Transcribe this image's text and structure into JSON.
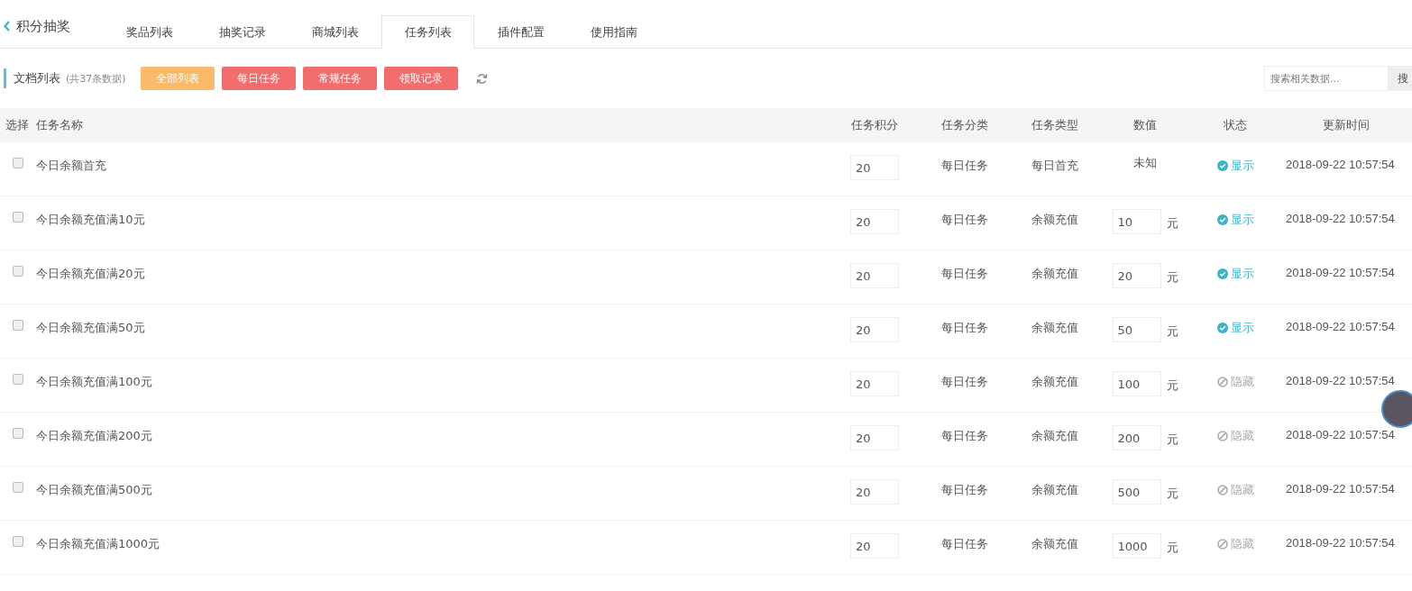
{
  "header": {
    "back_title": "积分抽奖",
    "tabs": [
      {
        "label": "奖品列表",
        "selected": false
      },
      {
        "label": "抽奖记录",
        "selected": false
      },
      {
        "label": "商城列表",
        "selected": false
      },
      {
        "label": "任务列表",
        "selected": true
      },
      {
        "label": "插件配置",
        "selected": false
      },
      {
        "label": "使用指南",
        "selected": false
      }
    ]
  },
  "toolbar": {
    "title": "文档列表",
    "count": "(共37条数据)",
    "filters": [
      {
        "label": "全部列表",
        "selected": true
      },
      {
        "label": "每日任务",
        "selected": false
      },
      {
        "label": "常规任务",
        "selected": false
      },
      {
        "label": "领取记录",
        "selected": false
      }
    ],
    "search": {
      "placeholder": "搜索相关数据...",
      "button": "搜"
    }
  },
  "table": {
    "columns": [
      "选择",
      "任务名称",
      "任务积分",
      "任务分类",
      "任务类型",
      "数值",
      "状态",
      "更新时间"
    ],
    "rows": [
      {
        "checked": false,
        "name": "今日余额首充",
        "points": "20",
        "category": "每日任务",
        "type": "每日首充",
        "value": {
          "kind": "text",
          "text": "未知"
        },
        "status": {
          "visible": true,
          "label": "显示"
        },
        "updated": "2018-09-22 10:57:54"
      },
      {
        "checked": false,
        "name": "今日余额充值满10元",
        "points": "20",
        "category": "每日任务",
        "type": "余额充值",
        "value": {
          "kind": "input",
          "text": "10",
          "unit": "元"
        },
        "status": {
          "visible": true,
          "label": "显示"
        },
        "updated": "2018-09-22 10:57:54"
      },
      {
        "checked": false,
        "name": "今日余额充值满20元",
        "points": "20",
        "category": "每日任务",
        "type": "余额充值",
        "value": {
          "kind": "input",
          "text": "20",
          "unit": "元"
        },
        "status": {
          "visible": true,
          "label": "显示"
        },
        "updated": "2018-09-22 10:57:54"
      },
      {
        "checked": false,
        "name": "今日余额充值满50元",
        "points": "20",
        "category": "每日任务",
        "type": "余额充值",
        "value": {
          "kind": "input",
          "text": "50",
          "unit": "元"
        },
        "status": {
          "visible": true,
          "label": "显示"
        },
        "updated": "2018-09-22 10:57:54"
      },
      {
        "checked": false,
        "name": "今日余额充值满100元",
        "points": "20",
        "category": "每日任务",
        "type": "余额充值",
        "value": {
          "kind": "input",
          "text": "100",
          "unit": "元"
        },
        "status": {
          "visible": false,
          "label": "隐藏"
        },
        "updated": "2018-09-22 10:57:54"
      },
      {
        "checked": false,
        "name": "今日余额充值满200元",
        "points": "20",
        "category": "每日任务",
        "type": "余额充值",
        "value": {
          "kind": "input",
          "text": "200",
          "unit": "元"
        },
        "status": {
          "visible": false,
          "label": "隐藏"
        },
        "updated": "2018-09-22 10:57:54"
      },
      {
        "checked": false,
        "name": "今日余额充值满500元",
        "points": "20",
        "category": "每日任务",
        "type": "余额充值",
        "value": {
          "kind": "input",
          "text": "500",
          "unit": "元"
        },
        "status": {
          "visible": false,
          "label": "隐藏"
        },
        "updated": "2018-09-22 10:57:54"
      },
      {
        "checked": false,
        "name": "今日余额充值满1000元",
        "points": "20",
        "category": "每日任务",
        "type": "余额充值",
        "value": {
          "kind": "input",
          "text": "1000",
          "unit": "元"
        },
        "status": {
          "visible": false,
          "label": "隐藏"
        },
        "updated": "2018-09-22 10:57:54"
      }
    ]
  }
}
